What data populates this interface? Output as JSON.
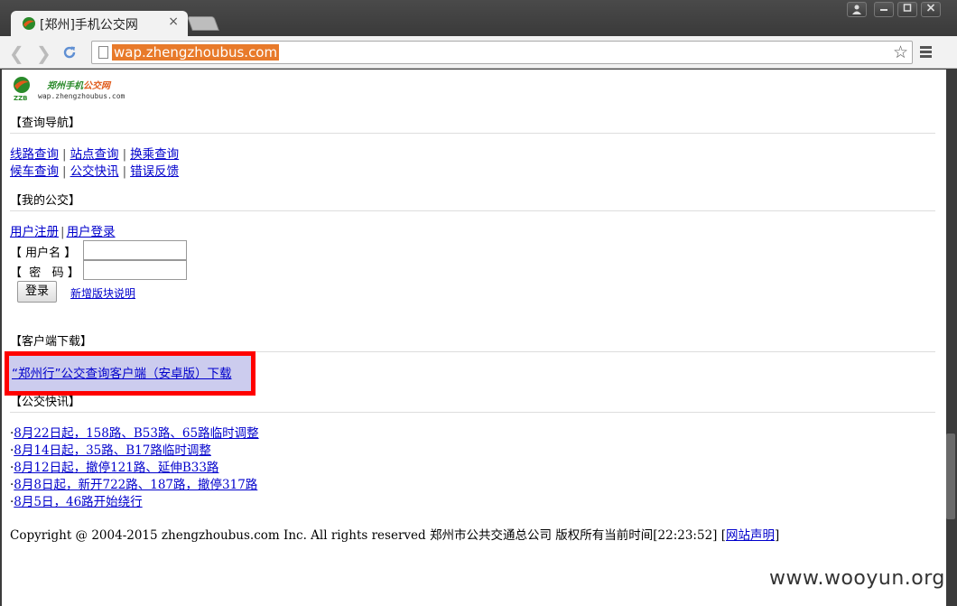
{
  "browser": {
    "tab_title": "[郑州]手机公交网",
    "tab_close": "×",
    "url": "wap.zhengzhoubus.com",
    "window_buttons": [
      "user-icon",
      "minimize-icon",
      "maximize-icon",
      "close-icon"
    ]
  },
  "logo": {
    "name_part1": "郑州手机",
    "name_part2": "公交网",
    "url": "wap.zhengzhoubus.com",
    "mark_text": "ZZB",
    "colors": {
      "green": "#2a8a2a",
      "orange": "#e05a1a"
    }
  },
  "sections": {
    "nav_head": "【查询导航】",
    "mybus_head": "【我的公交】",
    "client_head": "【客户端下载】",
    "news_head": "【公交快讯】"
  },
  "nav": {
    "row1": [
      "线路查询",
      "站点查询",
      "换乘查询"
    ],
    "row2": [
      "候车查询",
      "公交快讯",
      "错误反馈"
    ],
    "separator": "|"
  },
  "account": {
    "register": "用户注册",
    "login_link": "用户登录",
    "username_label": "【 用户名 】",
    "password_label": "【  密   码 】",
    "username_value": "",
    "password_value": "",
    "login_button": "登录",
    "new_feature_link": "新增版块说明"
  },
  "client": {
    "download_link": "“郑州行”公交查询客户端（安卓版）下载",
    "highlight_color": "#ff0000"
  },
  "news": [
    "8月22日起，158路、B53路、65路临时调整",
    "8月14日起，35路、B17路临时调整",
    "8月12日起，撤停121路、延伸B33路",
    "8月8日起，新开722路、187路，撤停317路",
    "8月5日，46路开始绕行"
  ],
  "news_bullet": "·",
  "footer": {
    "copyright": "Copyright @ 2004-2015 zhengzhoubus.com Inc. All rights reserved   郑州市公共交通总公司 版权所有当前时间[22:23:52] [",
    "disclaimer_link": "网站声明",
    "close_bracket": "]"
  },
  "watermark": "www.wooyun.org"
}
